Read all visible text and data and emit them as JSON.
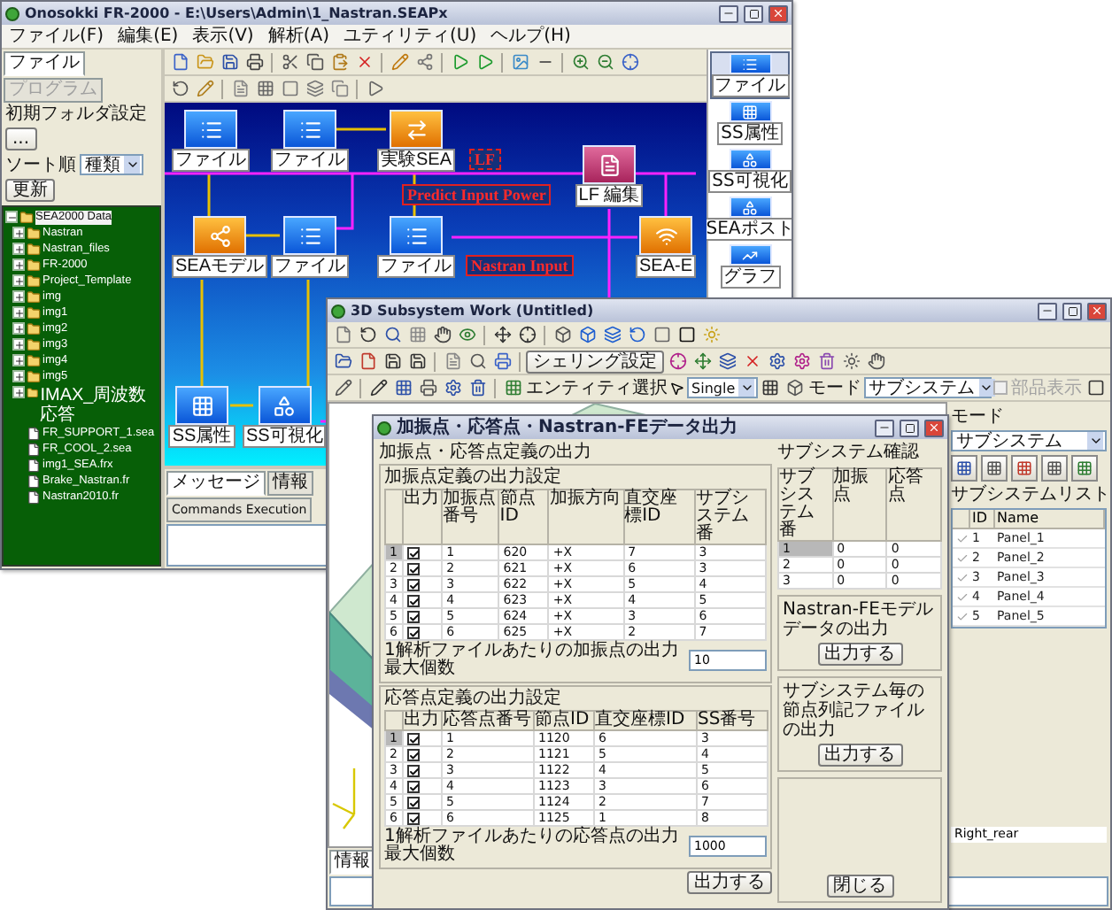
{
  "main_window": {
    "title": "Onosokki FR-2000 - E:\\Users\\Admin\\1_Nastran.SEAPx",
    "menu": [
      "ファイル(F)",
      "編集(E)",
      "表示(V)",
      "解析(A)",
      "ユティリティ(U)",
      "ヘルプ(H)"
    ],
    "file_panel": {
      "tabs": [
        {
          "label": "ファイル",
          "selected": true,
          "disabled": false
        },
        {
          "label": "プログラム",
          "selected": false,
          "disabled": true
        }
      ],
      "folder_label": "初期フォルダ設定",
      "browse_button": "...",
      "sort_label": "ソート順",
      "sort_value": "種類",
      "refresh_button": "更新",
      "tree": [
        {
          "label": "SEA2000 Data",
          "kind": "folder",
          "expanded": true,
          "selected": true,
          "children": [
            {
              "label": "Nastran",
              "kind": "folder",
              "expanded": false,
              "selected": false
            },
            {
              "label": "Nastran_files",
              "kind": "folder",
              "expanded": false,
              "selected": false
            },
            {
              "label": "FR-2000",
              "kind": "folder",
              "expanded": false,
              "selected": false
            },
            {
              "label": "Project_Template",
              "kind": "folder",
              "expanded": false,
              "selected": false
            },
            {
              "label": "img",
              "kind": "folder",
              "expanded": false,
              "selected": false
            },
            {
              "label": "img1",
              "kind": "folder",
              "expanded": false,
              "selected": false
            },
            {
              "label": "img2",
              "kind": "folder",
              "expanded": false,
              "selected": false
            },
            {
              "label": "img3",
              "kind": "folder",
              "expanded": false,
              "selected": false
            },
            {
              "label": "img4",
              "kind": "folder",
              "expanded": false,
              "selected": false
            },
            {
              "label": "img5",
              "kind": "folder",
              "expanded": false,
              "selected": false
            },
            {
              "label": "IMAX_周波数応答",
              "kind": "folder",
              "expanded": false,
              "selected": false
            },
            {
              "label": "FR_SUPPORT_1.sea",
              "kind": "file",
              "selected": false
            },
            {
              "label": "FR_COOL_2.sea",
              "kind": "file",
              "selected": false
            },
            {
              "label": "img1_SEA.frx",
              "kind": "file",
              "selected": false
            },
            {
              "label": "Brake_Nastran.fr",
              "kind": "file",
              "selected": false
            },
            {
              "label": "Nastran2010.fr",
              "kind": "file",
              "selected": false
            }
          ]
        }
      ]
    },
    "canvas": {
      "nodes": [
        {
          "label": "ファイル",
          "kind": "file"
        },
        {
          "label": "ファイル",
          "kind": "file"
        },
        {
          "label": "実験SEA",
          "kind": "experiment"
        },
        {
          "label": "SEAモデル",
          "kind": "model"
        },
        {
          "label": "ファイル",
          "kind": "file"
        },
        {
          "label": "ファイル",
          "kind": "file"
        },
        {
          "label": "LF 編集",
          "kind": "lf-edit"
        },
        {
          "label": "SEA-E",
          "kind": "sea-e"
        },
        {
          "label": "SS属性",
          "kind": "ss-attr"
        },
        {
          "label": "SS可視化",
          "kind": "ss-vis"
        }
      ],
      "annotations": [
        "LF",
        "Predict Input Power",
        "Nastran Input"
      ]
    },
    "palette": [
      {
        "label": "ファイル",
        "kind": "file",
        "selected": true
      },
      {
        "label": "SS属性",
        "kind": "ss-attr",
        "selected": false
      },
      {
        "label": "SS可視化",
        "kind": "ss-vis",
        "selected": false
      },
      {
        "label": "SEAポスト",
        "kind": "sea-post",
        "selected": false
      },
      {
        "label": "グラフ",
        "kind": "graph",
        "selected": false
      }
    ],
    "message_tabs": [
      {
        "label": "メッセージ",
        "selected": true
      },
      {
        "label": "情報",
        "selected": false
      },
      {
        "label": "Commands Execution",
        "selected": false
      }
    ]
  },
  "subsystem_window": {
    "title": "3D Subsystem Work (Untitled)",
    "shading_button": "シェリング設定",
    "entity_label": "エンティティ選択",
    "entity_select": "Single",
    "mode_label": "モード",
    "mode_select": "サブシステム",
    "parts_display": {
      "label": "部品表示",
      "checked": false,
      "disabled": true
    },
    "side_panel": {
      "mode_label": "モード",
      "mode_select": "サブシステム",
      "list_title": "サブシステムリスト",
      "columns": [
        "ID",
        "Name"
      ],
      "rows": [
        {
          "id": "1",
          "name": "Panel_1",
          "visible": true
        },
        {
          "id": "2",
          "name": "Panel_2",
          "visible": true
        },
        {
          "id": "3",
          "name": "Panel_3",
          "visible": true
        },
        {
          "id": "4",
          "name": "Panel_4",
          "visible": true
        },
        {
          "id": "5",
          "name": "Panel_5",
          "visible": true
        }
      ],
      "footer": "Right_rear"
    },
    "info_tabs": [
      {
        "label": "情報",
        "selected": true
      }
    ]
  },
  "export_dialog": {
    "title": "加振点・応答点・Nastran-FEデータ出力",
    "section": "加振点・応答点定義の出力",
    "excitation": {
      "title": "加振点定義の出力設定",
      "output_column": "出力",
      "columns": [
        "加振点番号",
        "節点ID",
        "加振方向",
        "直交座標ID",
        "サブシステム番"
      ],
      "rows": [
        {
          "index": "1",
          "selected": true,
          "output": true,
          "cells": [
            "1",
            "620",
            "+X",
            "7",
            "3"
          ]
        },
        {
          "index": "2",
          "selected": false,
          "output": true,
          "cells": [
            "2",
            "621",
            "+X",
            "6",
            "3"
          ]
        },
        {
          "index": "3",
          "selected": false,
          "output": true,
          "cells": [
            "3",
            "622",
            "+X",
            "5",
            "4"
          ]
        },
        {
          "index": "4",
          "selected": false,
          "output": true,
          "cells": [
            "4",
            "623",
            "+X",
            "4",
            "5"
          ]
        },
        {
          "index": "5",
          "selected": false,
          "output": true,
          "cells": [
            "5",
            "624",
            "+X",
            "3",
            "6"
          ]
        },
        {
          "index": "6",
          "selected": false,
          "output": true,
          "cells": [
            "6",
            "625",
            "+X",
            "2",
            "7"
          ]
        }
      ],
      "count_label": "1解析ファイルあたりの加振点の出力最大個数",
      "count_value": "10"
    },
    "response": {
      "title": "応答点定義の出力設定",
      "output_column": "出力",
      "columns": [
        "応答点番号",
        "節点ID",
        "直交座標ID",
        "SS番号"
      ],
      "rows": [
        {
          "index": "1",
          "selected": true,
          "output": true,
          "cells": [
            "1",
            "1120",
            "6",
            "3"
          ]
        },
        {
          "index": "2",
          "selected": false,
          "output": true,
          "cells": [
            "2",
            "1121",
            "5",
            "4"
          ]
        },
        {
          "index": "3",
          "selected": false,
          "output": true,
          "cells": [
            "3",
            "1122",
            "4",
            "5"
          ]
        },
        {
          "index": "4",
          "selected": false,
          "output": true,
          "cells": [
            "4",
            "1123",
            "3",
            "6"
          ]
        },
        {
          "index": "5",
          "selected": false,
          "output": true,
          "cells": [
            "5",
            "1124",
            "2",
            "7"
          ]
        },
        {
          "index": "6",
          "selected": false,
          "output": true,
          "cells": [
            "6",
            "1125",
            "1",
            "8"
          ]
        }
      ],
      "count_label": "1解析ファイルあたりの応答点の出力最大個数",
      "count_value": "1000"
    },
    "output_button": "出力する",
    "check": {
      "title": "サブシステム確認",
      "columns": [
        "サブシステム番",
        "加振点",
        "応答点"
      ],
      "rows": [
        {
          "selected": true,
          "cells": [
            "1",
            "0",
            "0"
          ]
        },
        {
          "selected": false,
          "cells": [
            "2",
            "0",
            "0"
          ]
        },
        {
          "selected": false,
          "cells": [
            "3",
            "0",
            "0"
          ]
        }
      ]
    },
    "nastran_label": "Nastran-FEモデルデータの出力",
    "nastran_button": "出力する",
    "node_file_label": "サブシステム毎の節点列記ファイルの出力",
    "node_file_button": "出力する",
    "close_button": "閉じる"
  }
}
